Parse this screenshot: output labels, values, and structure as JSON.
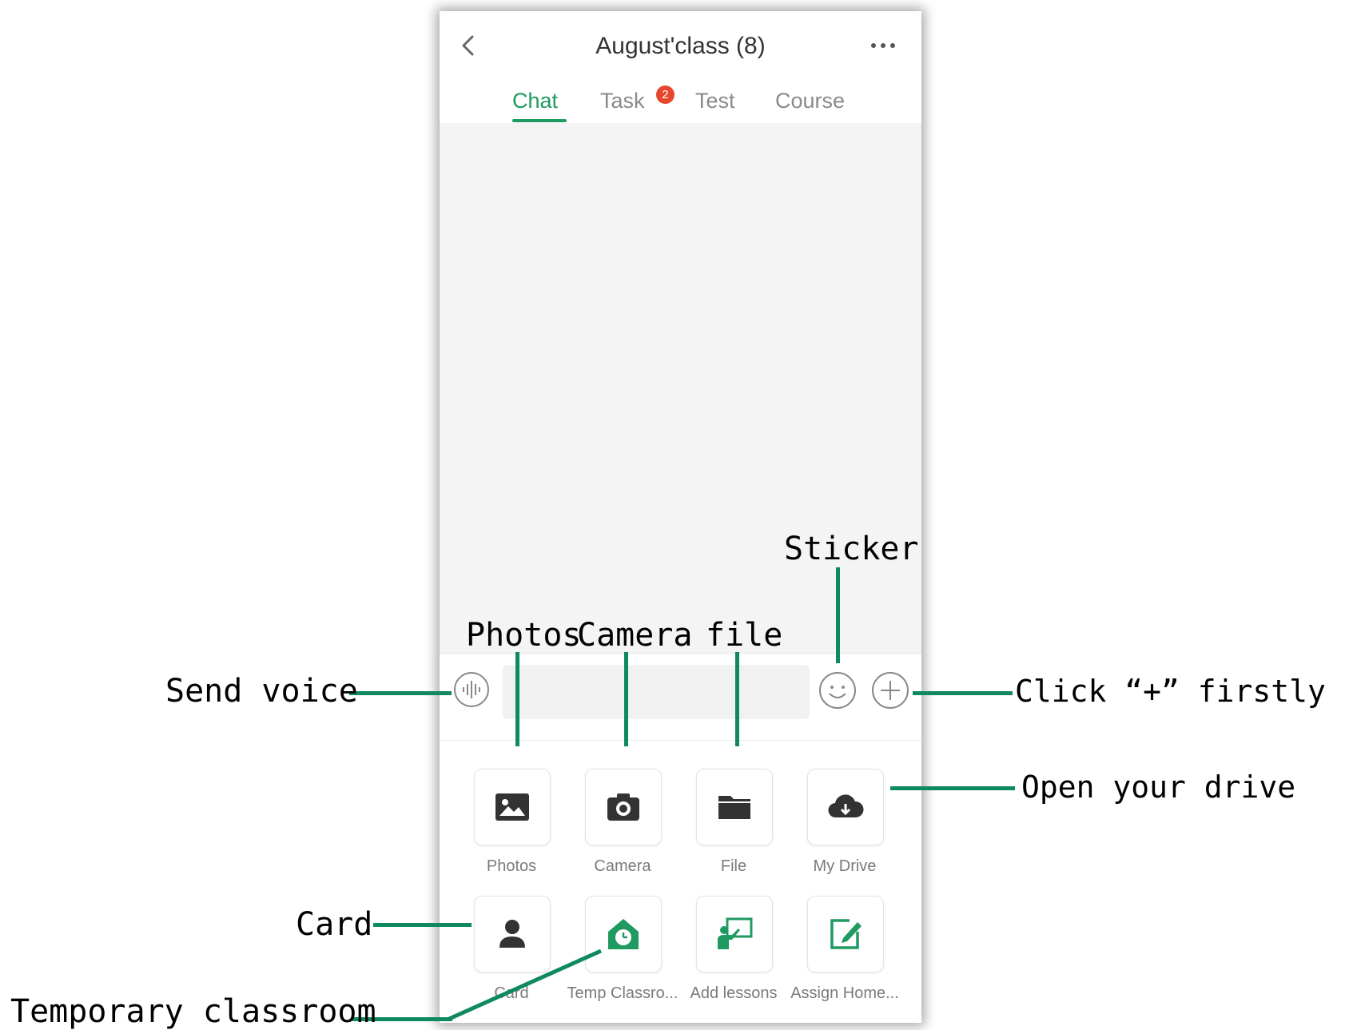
{
  "app": {
    "title": "August'class (8)",
    "tabs": [
      {
        "label": "Chat",
        "active": true
      },
      {
        "label": "Task",
        "badge": "2"
      },
      {
        "label": "Test"
      },
      {
        "label": "Course"
      }
    ]
  },
  "input": {
    "placeholder": ""
  },
  "panel": {
    "items": [
      {
        "label": "Photos",
        "icon": "photo-icon"
      },
      {
        "label": "Camera",
        "icon": "camera-icon"
      },
      {
        "label": "File",
        "icon": "folder-icon"
      },
      {
        "label": "My Drive",
        "icon": "cloud-download-icon"
      },
      {
        "label": "Card",
        "icon": "person-icon"
      },
      {
        "label": "Temp Classro...",
        "icon": "clock-house-icon"
      },
      {
        "label": "Add lessons",
        "icon": "teacher-board-icon"
      },
      {
        "label": "Assign Home...",
        "icon": "edit-square-icon"
      }
    ]
  },
  "callouts": {
    "sticker": "Sticker",
    "photos": "Photos",
    "camera": "Camera",
    "file": "file",
    "send_voice": "Send voice",
    "click_plus": "Click “+” firstly",
    "open_drive": "Open your drive",
    "card": "Card",
    "temp_classroom": "Temporary classroom"
  },
  "colors": {
    "accent": "#1f9a60",
    "badge": "#e8462d",
    "callout_line": "#0f8a5f"
  }
}
